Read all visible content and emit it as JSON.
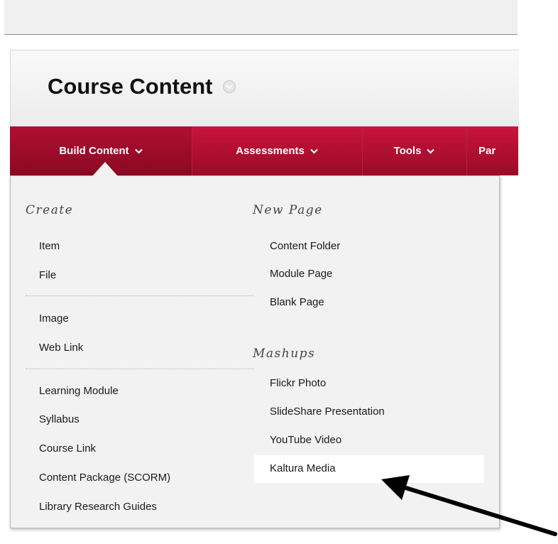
{
  "header": {
    "title": "Course Content"
  },
  "nav": {
    "items": [
      {
        "label": "Build Content",
        "chevron": "chevron-down-icon"
      },
      {
        "label": "Assessments",
        "chevron": "chevron-down-icon"
      },
      {
        "label": "Tools",
        "chevron": "chevron-down-icon"
      },
      {
        "label": "Par"
      }
    ]
  },
  "menu": {
    "create": {
      "heading": "Create",
      "group1": [
        "Item",
        "File"
      ],
      "group2": [
        "Image",
        "Web Link"
      ],
      "group3": [
        "Learning Module",
        "Syllabus",
        "Course Link",
        "Content Package (SCORM)",
        "Library Research Guides"
      ]
    },
    "new_page": {
      "heading": "New Page",
      "items": [
        "Content Folder",
        "Module Page",
        "Blank Page"
      ]
    },
    "mashups": {
      "heading": "Mashups",
      "items": [
        "Flickr Photo",
        "SlideShare Presentation",
        "YouTube Video",
        "Kaltura Media"
      ]
    }
  },
  "colors": {
    "nav_bg": "#b3102f",
    "menu_bg": "#f2f2f2",
    "highlight_bg": "#ffffff",
    "arrow": "#000000"
  },
  "icons": {
    "title_menu": "chevron-down-circle-icon",
    "annotation": "arrow-icon"
  }
}
